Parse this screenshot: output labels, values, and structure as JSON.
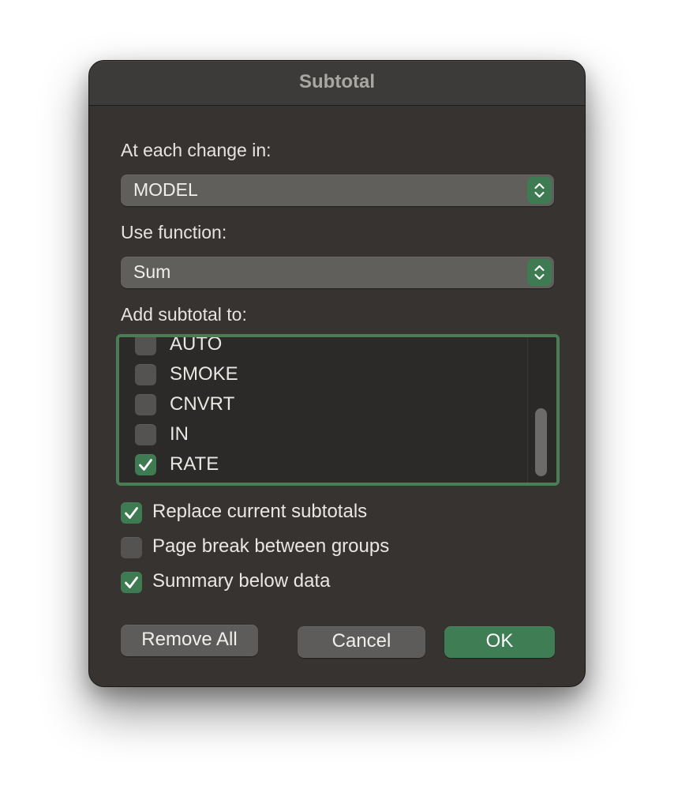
{
  "dialog": {
    "title": "Subtotal"
  },
  "change_in": {
    "label": "At each change in:",
    "selected": "MODEL"
  },
  "function": {
    "label": "Use function:",
    "selected": "Sum"
  },
  "add_subtotal": {
    "label": "Add subtotal to:",
    "items": [
      {
        "label": "AUTO",
        "checked": false
      },
      {
        "label": "SMOKE",
        "checked": false
      },
      {
        "label": "CNVRT",
        "checked": false
      },
      {
        "label": "IN",
        "checked": false
      },
      {
        "label": "RATE",
        "checked": true
      }
    ]
  },
  "options": {
    "replace": {
      "label": "Replace current subtotals",
      "checked": true
    },
    "page_break": {
      "label": "Page break between groups",
      "checked": false
    },
    "summary_below": {
      "label": "Summary below data",
      "checked": true
    }
  },
  "buttons": {
    "remove_all": "Remove All",
    "cancel": "Cancel",
    "ok": "OK"
  },
  "colors": {
    "accent": "#3e7a52",
    "dialog_bg": "#363330",
    "focus_ring": "#4a7c55"
  },
  "icons": {
    "stepper": "chevron-up-down-icon",
    "check": "checkmark-icon"
  }
}
